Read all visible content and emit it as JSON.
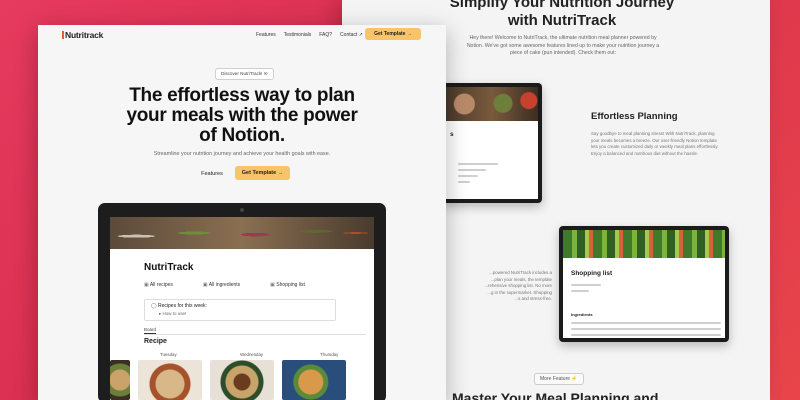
{
  "back": {
    "title_line1": "Simplify Your Nutrition Journey",
    "title_line2": "with NutriTrack",
    "intro_line1": "Hey there! Welcome to NutriTrack, the ultimate nutrition meal planner powered by",
    "intro_line2": "Notion. We've got some awesome features lined up to make your nutrition journey a",
    "intro_line3": "piece of cake (pun intended). Check them out:",
    "feature_title": "Effortless Planning",
    "feature_desc_line1": "Say goodbye to meal planning stress! With NutriTrack, planning",
    "feature_desc_line2": "your meals becomes a breeze. Our user-friendly Notion template",
    "feature_desc_line3": "lets you create customized daily or weekly meal plans effortlessly.",
    "feature_desc_line4": "Enjoy a balanced and nutritious diet without the hassle.",
    "feature2_desc_line1": "...powered NutriTrack includes a",
    "feature2_desc_line2": "...plan your meals, the template",
    "feature2_desc_line3": "...rehensive shopping list. No more",
    "feature2_desc_line4": "...g in the supermarket. Shopping",
    "feature2_desc_line5": "...s and stress-free.",
    "tablet_b_heading": "Shopping list",
    "tablet_b_sub": "Ingredients",
    "more_badge": "More Feature ⚡",
    "bottom_title": "Master Your Meal Planning and"
  },
  "nav": {
    "logo": "Nutritrack",
    "links": [
      "Features",
      "Testimonials",
      "FAQ?",
      "Contact ↗"
    ],
    "cta": "Get Template →"
  },
  "hero": {
    "badge": "Discover NutriTrack! ✉",
    "title_line1": "The effortless way to plan",
    "title_line2": "your meals with the power",
    "title_line3": "of Notion.",
    "subtitle": "Streamline your nutrition journey and achieve your health goals with ease.",
    "features_button": "Features",
    "cta_button": "Get Template →"
  },
  "app": {
    "title": "NutriTrack",
    "links": [
      "All recipes",
      "All ingredients",
      "Shopping list"
    ],
    "callout_title": "Recipes for this week:",
    "callout_item": "How to use!",
    "board_tab": "Board",
    "recipe_heading": "Recipe",
    "days": [
      "Tuesday",
      "Wednesday",
      "Thursday"
    ]
  }
}
